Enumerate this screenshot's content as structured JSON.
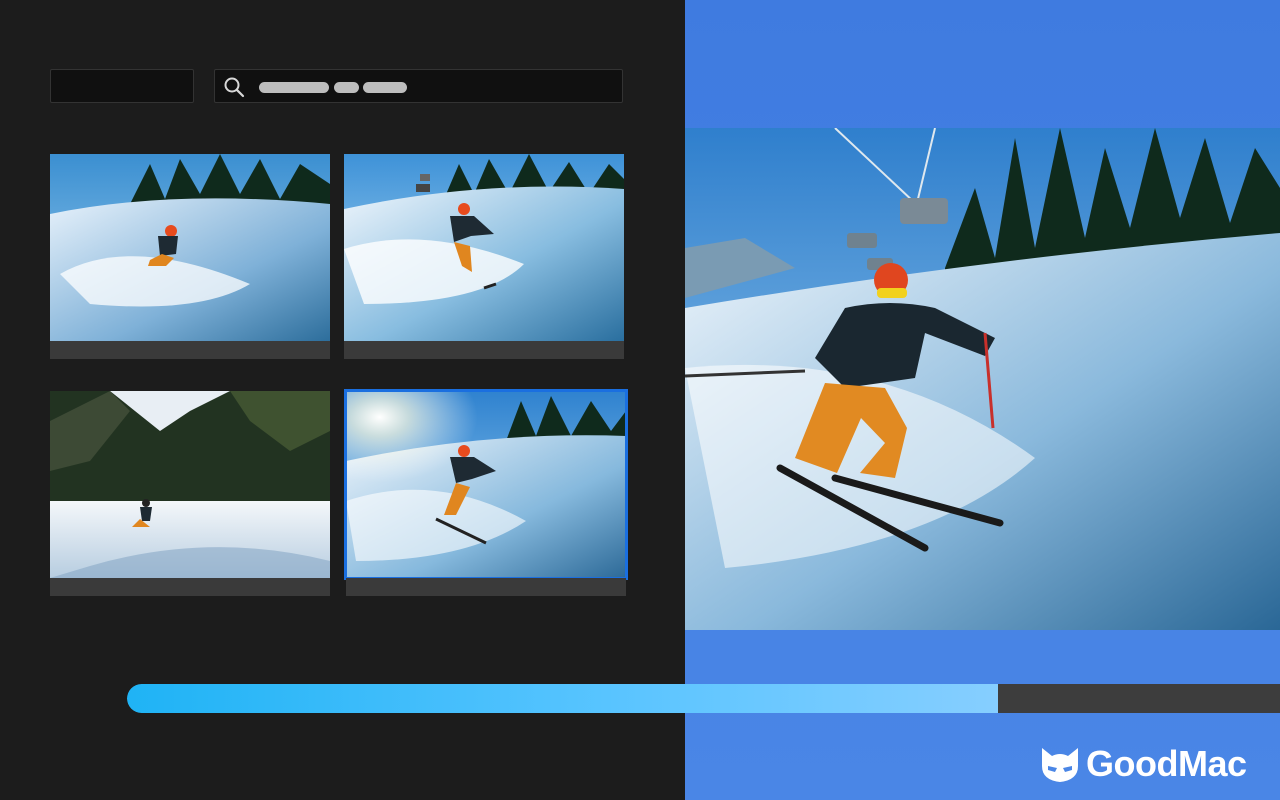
{
  "brand": {
    "name": "GoodMac"
  },
  "toolbar": {
    "filter_icon": "none",
    "search_icon": "search-icon"
  },
  "gallery": {
    "items": [
      {
        "scene": "skier-carving-snow-spray"
      },
      {
        "scene": "skier-poles-ski-lift"
      },
      {
        "scene": "distant-skier-mountain"
      },
      {
        "scene": "skier-sunburst",
        "selected": true
      }
    ]
  },
  "progress": {
    "value": 0.755
  },
  "colors": {
    "accent": "#1a6fe0",
    "panel": "#1c1c1c",
    "preview_bg": "#4a86e6",
    "progress_start": "#1fb3f5",
    "progress_end": "#86ceff"
  }
}
